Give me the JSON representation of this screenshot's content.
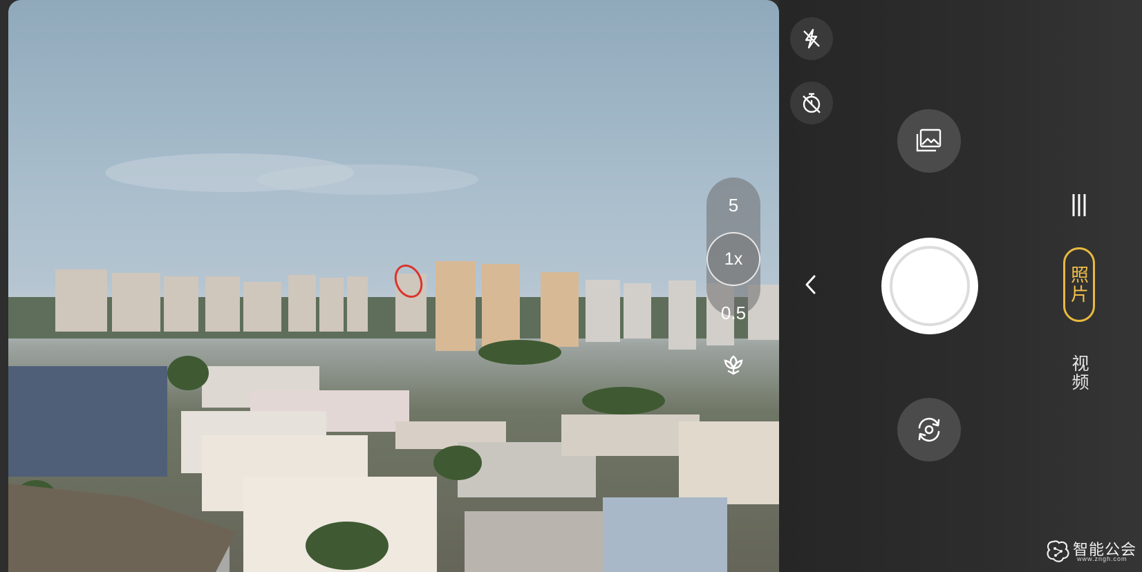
{
  "viewfinder": {
    "scene": "city-skyline"
  },
  "zoom": {
    "options": [
      "5",
      "1x",
      "0.5"
    ],
    "selected": "1x"
  },
  "controls": {
    "flash_icon": "flash-off-icon",
    "timer_icon": "timer-off-icon",
    "macro_icon": "macro-flower-icon",
    "gallery_icon": "gallery-icon",
    "flip_icon": "flip-camera-icon",
    "back_icon": "chevron-left-icon",
    "menu_icon": "menu-bars-icon"
  },
  "modes": {
    "photo": "照片",
    "video": "视频",
    "active": "照片"
  },
  "colors": {
    "active_mode": "#e7b93f",
    "focus_marker": "#d9342b"
  },
  "watermark": {
    "text": "智能公会",
    "url": "www.zngh.com"
  }
}
